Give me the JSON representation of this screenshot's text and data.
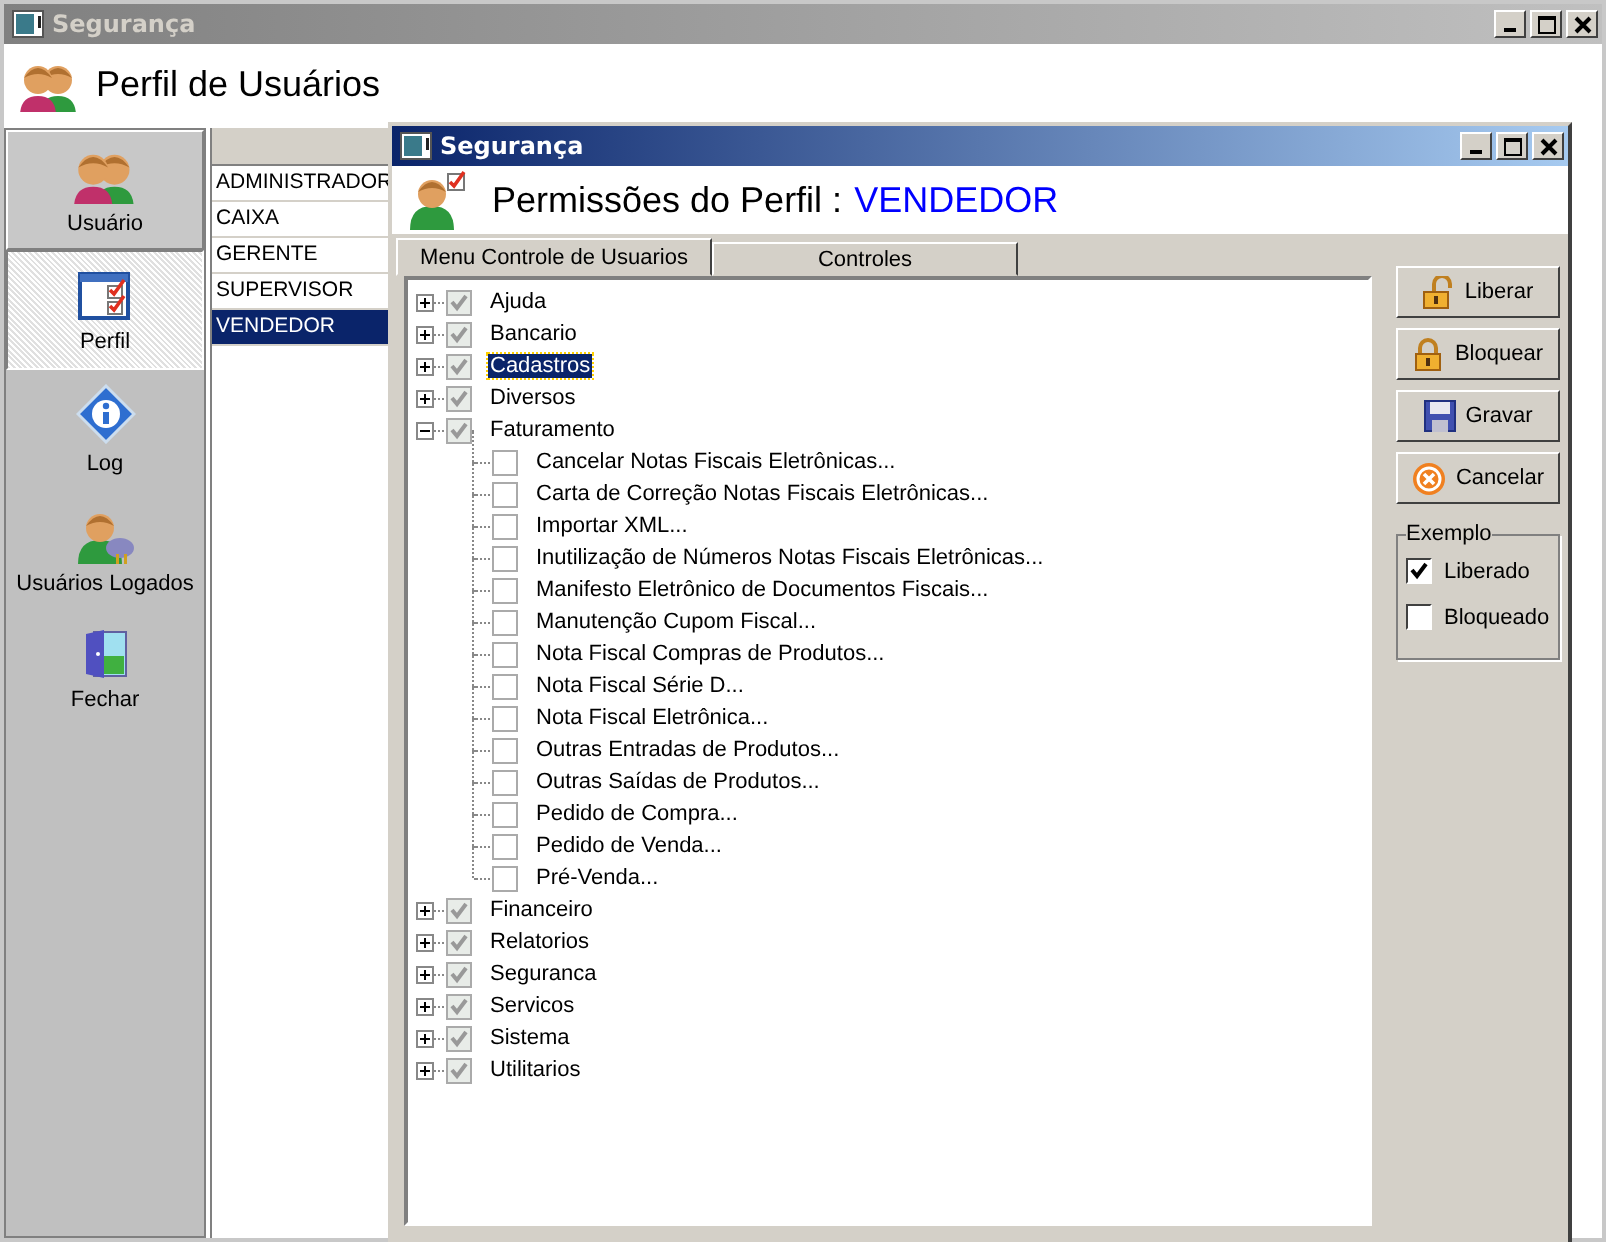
{
  "main_window": {
    "title": "Segurança",
    "heading": "Perfil de Usuários"
  },
  "sidebar": {
    "items": [
      {
        "label": "Usuário",
        "selected": false
      },
      {
        "label": "Perfil",
        "selected": true
      },
      {
        "label": "Log",
        "selected": false
      },
      {
        "label": "Usuários Logados",
        "selected": false
      },
      {
        "label": "Fechar",
        "selected": false
      }
    ]
  },
  "profiles": {
    "rows": [
      {
        "name": "ADMINISTRADOR",
        "selected": false
      },
      {
        "name": "CAIXA",
        "selected": false
      },
      {
        "name": "GERENTE",
        "selected": false
      },
      {
        "name": "SUPERVISOR",
        "selected": false
      },
      {
        "name": "VENDEDOR",
        "selected": true
      }
    ]
  },
  "dialog": {
    "title": "Segurança",
    "heading": "Permissões do Perfil :",
    "profile": "VENDEDOR",
    "tabs": [
      {
        "label": "Menu Controle de Usuarios",
        "selected": true
      },
      {
        "label": "Controles",
        "selected": false
      }
    ],
    "tree": [
      {
        "label": "Ajuda",
        "checked": true,
        "expanded": false,
        "selected": false
      },
      {
        "label": "Bancario",
        "checked": true,
        "expanded": false,
        "selected": false
      },
      {
        "label": "Cadastros",
        "checked": true,
        "expanded": false,
        "selected": true
      },
      {
        "label": "Diversos",
        "checked": true,
        "expanded": false,
        "selected": false
      },
      {
        "label": "Faturamento",
        "checked": true,
        "expanded": true,
        "selected": false,
        "children": [
          {
            "label": "Cancelar Notas Fiscais Eletrônicas...",
            "checked": false,
            "selected": false
          },
          {
            "label": "Carta de Correção Notas Fiscais Eletrônicas...",
            "checked": false,
            "selected": false
          },
          {
            "label": "Importar XML...",
            "checked": false,
            "selected": false
          },
          {
            "label": "Inutilização de Números Notas Fiscais Eletrônicas...",
            "checked": false,
            "selected": false
          },
          {
            "label": "Manifesto Eletrônico de Documentos Fiscais...",
            "checked": false,
            "selected": false
          },
          {
            "label": "Manutenção Cupom Fiscal...",
            "checked": false,
            "selected": false
          },
          {
            "label": "Nota Fiscal Compras de Produtos...",
            "checked": false,
            "selected": false
          },
          {
            "label": "Nota Fiscal Série D...",
            "checked": false,
            "selected": false
          },
          {
            "label": "Nota Fiscal Eletrônica...",
            "checked": false,
            "selected": false
          },
          {
            "label": "Outras Entradas de Produtos...",
            "checked": false,
            "selected": false
          },
          {
            "label": "Outras Saídas de Produtos...",
            "checked": false,
            "selected": false
          },
          {
            "label": "Pedido de Compra...",
            "checked": false,
            "selected": false
          },
          {
            "label": "Pedido de Venda...",
            "checked": false,
            "selected": false
          },
          {
            "label": "Pré-Venda...",
            "checked": false,
            "selected": false
          }
        ]
      },
      {
        "label": "Financeiro",
        "checked": true,
        "expanded": false,
        "selected": false
      },
      {
        "label": "Relatorios",
        "checked": true,
        "expanded": false,
        "selected": false
      },
      {
        "label": "Seguranca",
        "checked": true,
        "expanded": false,
        "selected": false
      },
      {
        "label": "Servicos",
        "checked": true,
        "expanded": false,
        "selected": false
      },
      {
        "label": "Sistema",
        "checked": true,
        "expanded": false,
        "selected": false
      },
      {
        "label": "Utilitarios",
        "checked": true,
        "expanded": false,
        "selected": false
      }
    ],
    "buttons": [
      "Liberar",
      "Bloquear",
      "Gravar",
      "Cancelar"
    ],
    "legend": {
      "title": "Exemplo",
      "items": [
        {
          "label": "Liberado",
          "checked": true
        },
        {
          "label": "Bloqueado",
          "checked": false
        }
      ]
    }
  }
}
